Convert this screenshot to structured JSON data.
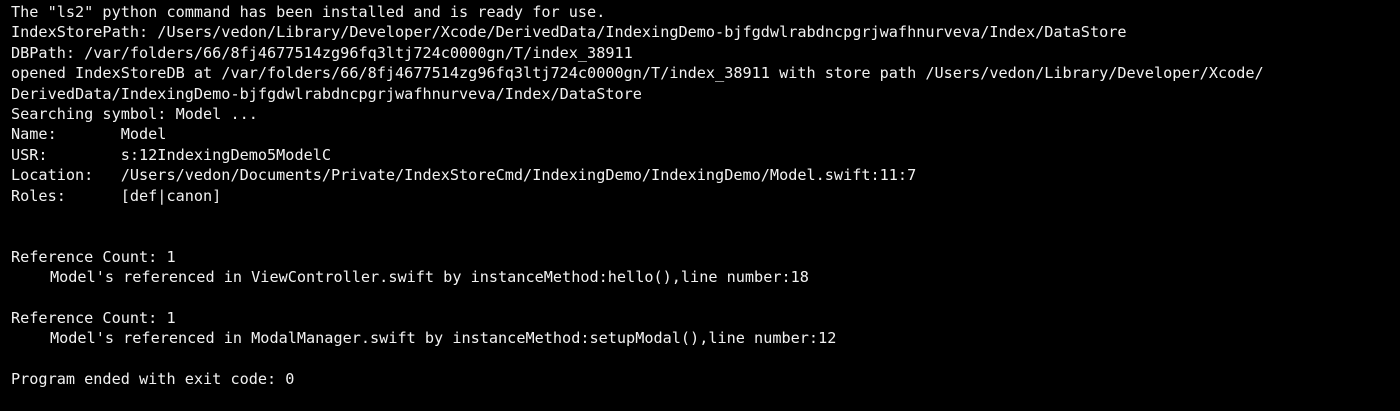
{
  "console": {
    "lines": [
      "The \"ls2\" python command has been installed and is ready for use.",
      "IndexStorePath: /Users/vedon/Library/Developer/Xcode/DerivedData/IndexingDemo-bjfgdwlrabdncpgrjwafhnurveva/Index/DataStore",
      "DBPath: /var/folders/66/8fj4677514zg96fq3ltj724c0000gn/T/index_38911",
      "opened IndexStoreDB at /var/folders/66/8fj4677514zg96fq3ltj724c0000gn/T/index_38911 with store path /Users/vedon/Library/Developer/Xcode/",
      "DerivedData/IndexingDemo-bjfgdwlrabdncpgrjwafhnurveva/Index/DataStore",
      "Searching symbol: Model ...",
      "Name:       Model",
      "USR:        s:12IndexingDemo5ModelC",
      "Location:   /Users/vedon/Documents/Private/IndexStoreCmd/IndexingDemo/IndexingDemo/Model.swift:11:7",
      "Roles:      [def|canon]"
    ],
    "references": [
      {
        "count": "Reference Count: 1",
        "detail": "Model's referenced in ViewController.swift by instanceMethod:hello(),line number:18"
      },
      {
        "count": "Reference Count: 1",
        "detail": "Model's referenced in ModalManager.swift by instanceMethod:setupModal(),line number:12"
      }
    ],
    "exit_message": "Program ended with exit code: 0"
  },
  "colors": {
    "background": "#000000",
    "text": "#f2f2f2"
  }
}
